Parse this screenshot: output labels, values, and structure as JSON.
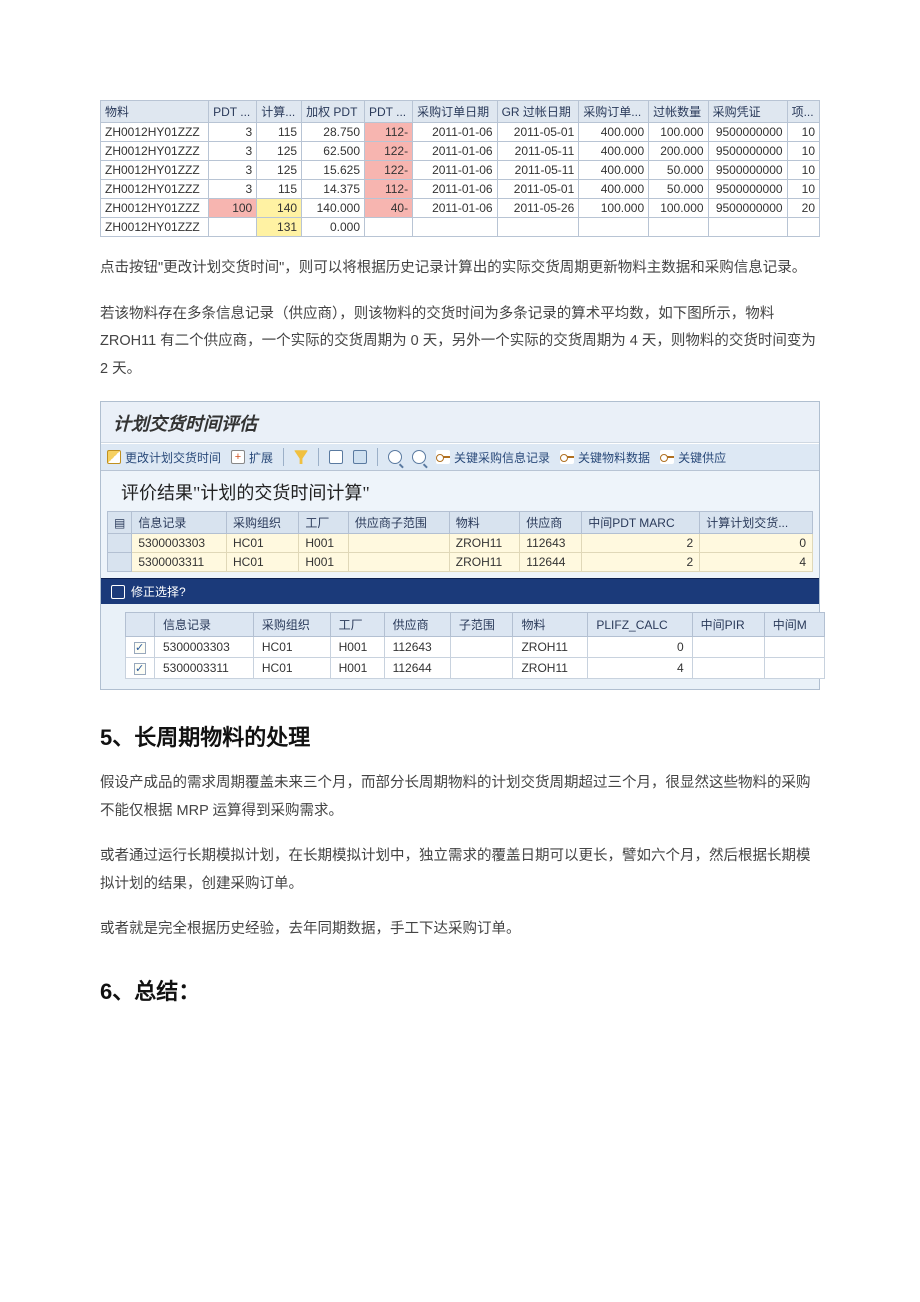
{
  "table1": {
    "headers": [
      "物料",
      "PDT ...",
      "计算...",
      "加权 PDT",
      "PDT ...",
      "采购订单日期",
      "GR 过帐日期",
      "采购订单...",
      "过帐数量",
      "采购凭证",
      "项..."
    ],
    "rows": [
      {
        "c": [
          "ZH0012HY01ZZZ",
          "3",
          "115",
          "28.750",
          "112-",
          "2011-01-06",
          "2011-05-01",
          "400.000",
          "100.000",
          "9500000000",
          "10"
        ],
        "hl": {}
      },
      {
        "c": [
          "ZH0012HY01ZZZ",
          "3",
          "125",
          "62.500",
          "122-",
          "2011-01-06",
          "2011-05-11",
          "400.000",
          "200.000",
          "9500000000",
          "10"
        ],
        "hl": {}
      },
      {
        "c": [
          "ZH0012HY01ZZZ",
          "3",
          "125",
          "15.625",
          "122-",
          "2011-01-06",
          "2011-05-11",
          "400.000",
          "50.000",
          "9500000000",
          "10"
        ],
        "hl": {}
      },
      {
        "c": [
          "ZH0012HY01ZZZ",
          "3",
          "115",
          "14.375",
          "112-",
          "2011-01-06",
          "2011-05-01",
          "400.000",
          "50.000",
          "9500000000",
          "10"
        ],
        "hl": {}
      },
      {
        "c": [
          "ZH0012HY01ZZZ",
          "100",
          "140",
          "140.000",
          "40-",
          "2011-01-06",
          "2011-05-26",
          "100.000",
          "100.000",
          "9500000000",
          "20"
        ],
        "hl": {
          "1": "p",
          "2": "y",
          "4": "p"
        }
      },
      {
        "c": [
          "ZH0012HY01ZZZ",
          "",
          "131",
          "0.000",
          "",
          "",
          "",
          "",
          "",
          "",
          ""
        ],
        "hl": {
          "2": "y"
        }
      }
    ]
  },
  "text": {
    "p1": "点击按钮\"更改计划交货时间\"，则可以将根据历史记录计算出的实际交货周期更新物料主数据和采购信息记录。",
    "p2": "若该物料存在多条信息记录（供应商），则该物料的交货时间为多条记录的算术平均数，如下图所示，物料 ZROH11 有二个供应商，一个实际的交货周期为 0 天，另外一个实际的交货周期为 4 天，则物料的交货时间变为 2 天。",
    "h5": "5、长周期物料的处理",
    "p3": "假设产成品的需求周期覆盖未来三个月，而部分长周期物料的计划交货周期超过三个月，很显然这些物料的采购不能仅根据 MRP 运算得到采购需求。",
    "p4": "或者通过运行长期模拟计划，在长期模拟计划中，独立需求的覆盖日期可以更长，譬如六个月，然后根据长期模拟计划的结果，创建采购订单。",
    "p5": "或者就是完全根据历史经验，去年同期数据，手工下达采购订单。",
    "h6": "6、总结："
  },
  "sap": {
    "title": "计划交货时间评估",
    "toolbar": {
      "btn1": "更改计划交货时间",
      "btn2": "扩展",
      "btn3": "关键采购信息记录",
      "btn4": "关键物料数据",
      "btn5": "关键供应"
    },
    "subtitle": "评价结果\"计划的交货时间计算\"",
    "t2": {
      "headers": [
        "信息记录",
        "采购组织",
        "工厂",
        "供应商子范围",
        "物料",
        "供应商",
        "中间PDT MARC",
        "计算计划交货..."
      ],
      "rows": [
        [
          "5300003303",
          "HC01",
          "H001",
          "",
          "ZROH11",
          "112643",
          "2",
          "0"
        ],
        [
          "5300003311",
          "HC01",
          "H001",
          "",
          "ZROH11",
          "112644",
          "2",
          "4"
        ]
      ]
    },
    "fixbar": "修正选择?",
    "t3": {
      "headers": [
        "信息记录",
        "采购组织",
        "工厂",
        "供应商",
        "子范围",
        "物料",
        "PLIFZ_CALC",
        "中间PIR",
        "中间M"
      ],
      "rows": [
        {
          "chk": true,
          "c": [
            "5300003303",
            "HC01",
            "H001",
            "112643",
            "",
            "ZROH11",
            "0",
            "",
            ""
          ]
        },
        {
          "chk": true,
          "c": [
            "5300003311",
            "HC01",
            "H001",
            "112644",
            "",
            "ZROH11",
            "4",
            "",
            ""
          ]
        }
      ]
    }
  }
}
